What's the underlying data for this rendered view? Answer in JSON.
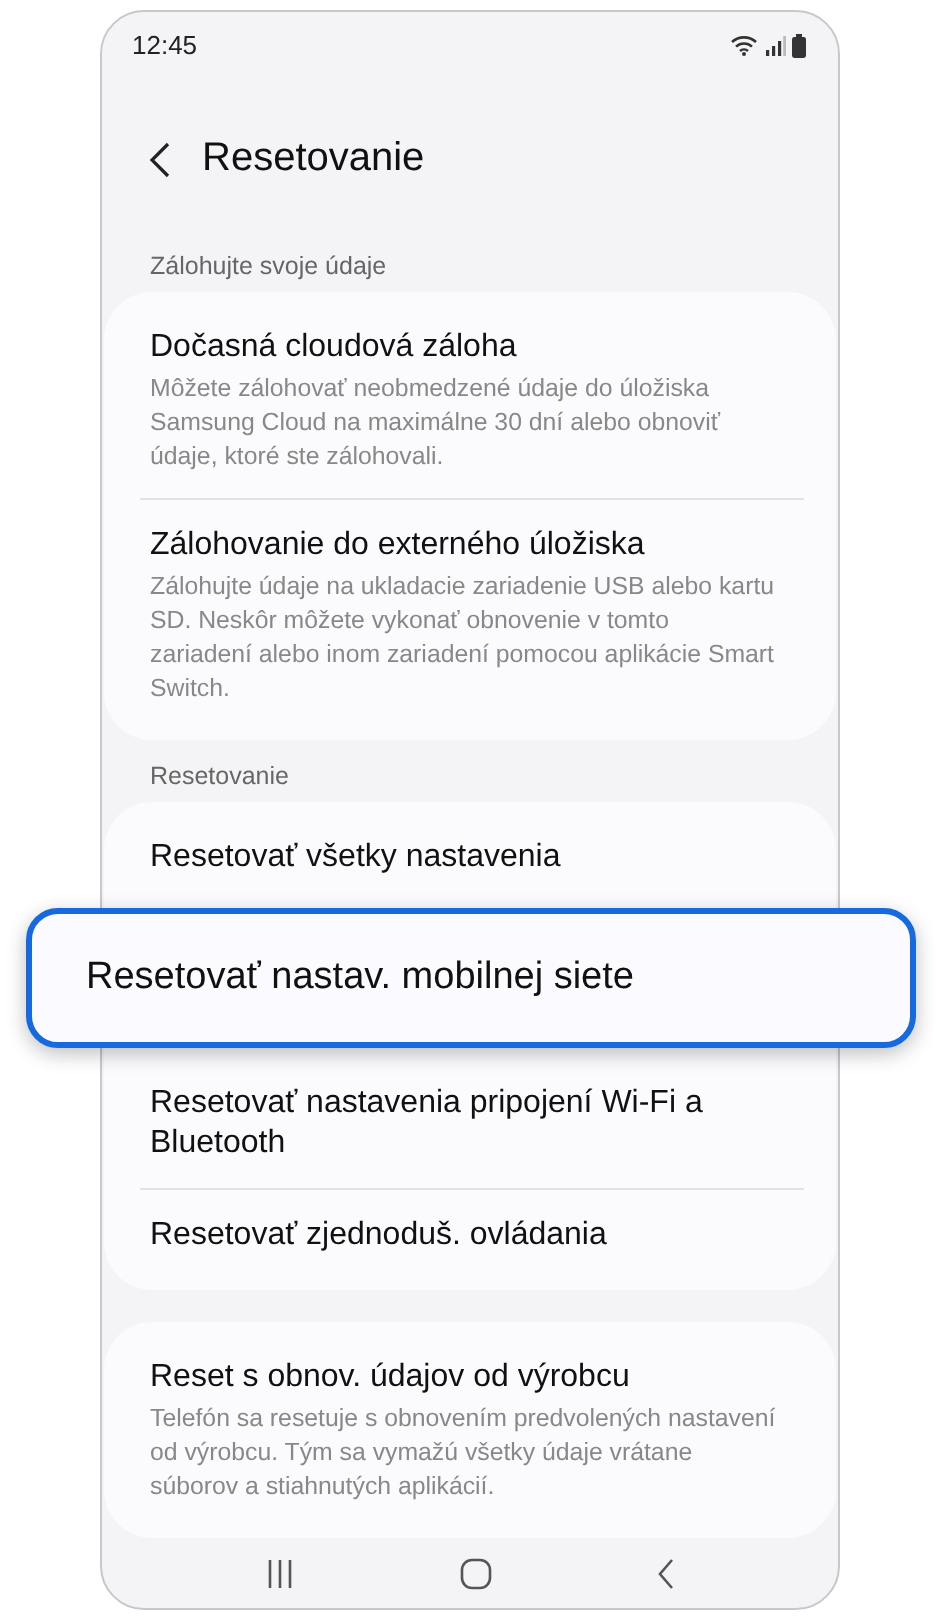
{
  "status_bar": {
    "time": "12:45"
  },
  "header": {
    "title": "Resetovanie"
  },
  "sections": [
    {
      "label": "Zálohujte svoje údaje",
      "items": [
        {
          "title": "Dočasná cloudová záloha",
          "description": "Môžete zálohovať neobmedzené údaje do úložiska Samsung Cloud na maximálne 30 dní alebo obnoviť údaje, ktoré ste zálohovali.",
          "highlighted": false
        },
        {
          "title": "Zálohovanie do externého úložiska",
          "description": "Zálohujte údaje na ukladacie zariadenie USB alebo kartu SD. Neskôr môžete vykonať obnovenie v tomto zariadení alebo inom zariadení pomocou aplikácie Smart Switch.",
          "highlighted": false
        }
      ]
    },
    {
      "label": "Resetovanie",
      "items": [
        {
          "title": "Resetovať všetky nastavenia",
          "highlighted": false
        },
        {
          "title": "Resetovať nastav. mobilnej siete",
          "highlighted": true
        },
        {
          "title": "Resetovať nastavenia pripojení Wi-Fi a Bluetooth",
          "highlighted": false
        },
        {
          "title": "Resetovať zjednoduš. ovládania",
          "highlighted": false
        }
      ]
    },
    {
      "items": [
        {
          "title": "Reset s obnov. údajov od výrobcu",
          "description": "Telefón sa resetuje s obnovením predvolených nastavení od výrobcu. Tým sa vymažú všetky údaje vrátane súborov a stiahnutých aplikácií.",
          "highlighted": false
        }
      ]
    }
  ]
}
